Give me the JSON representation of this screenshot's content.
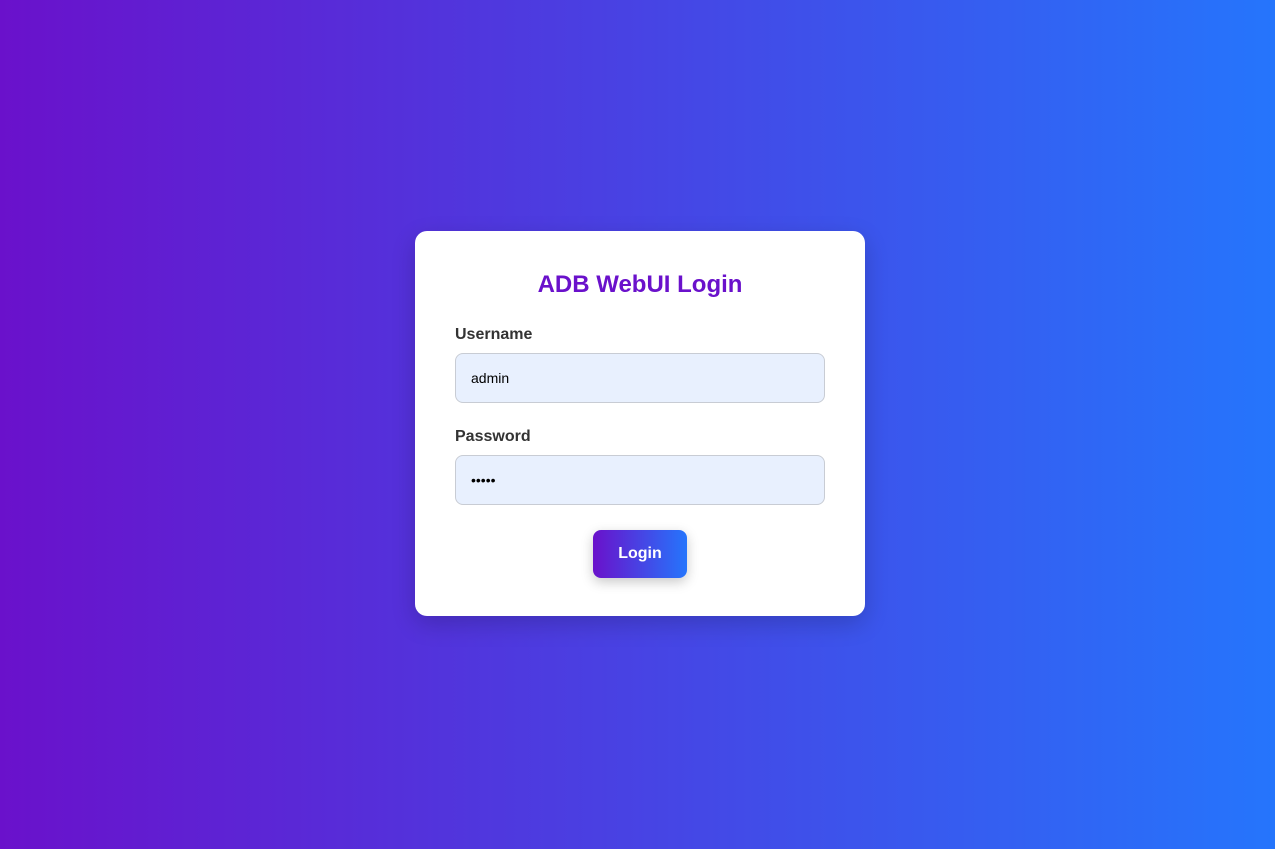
{
  "login": {
    "title": "ADB WebUI Login",
    "username_label": "Username",
    "username_value": "admin",
    "password_label": "Password",
    "password_value": "admin",
    "submit_label": "Login"
  },
  "colors": {
    "gradient_start": "#6a11cb",
    "gradient_end": "#2575fc",
    "title": "#6a11cb",
    "input_background": "#e8f0fe"
  }
}
